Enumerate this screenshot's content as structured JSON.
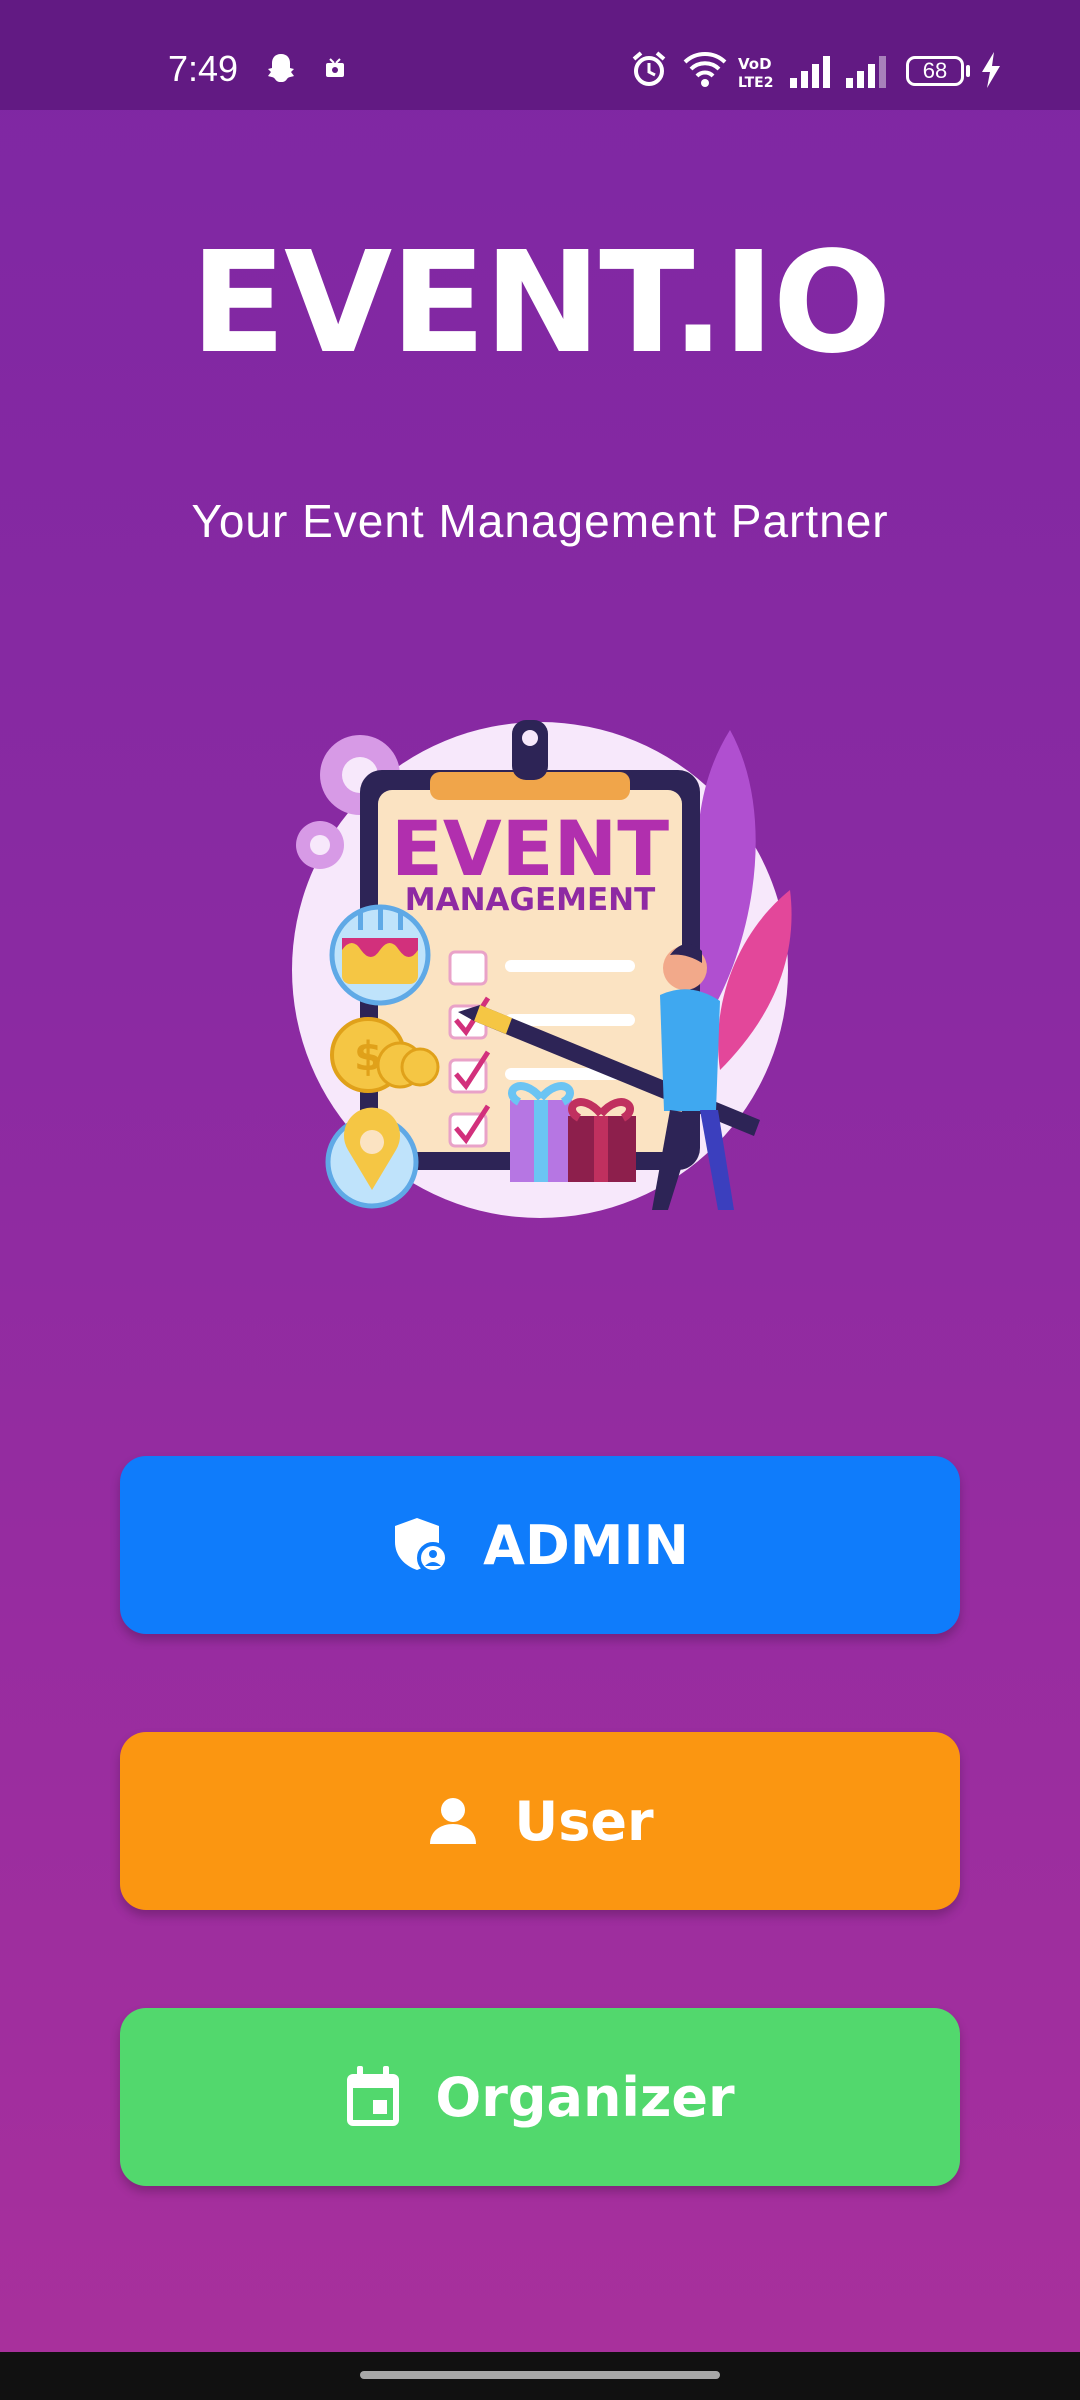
{
  "status_bar": {
    "time": "7:49",
    "battery_level": "68",
    "icons": [
      "snapchat-icon",
      "media-icon",
      "alarm-icon",
      "wifi-icon",
      "volte-icon",
      "signal-icon",
      "signal-icon-2",
      "battery-icon",
      "charging-icon"
    ]
  },
  "app": {
    "title": "EVENT.IO",
    "subtitle": "Your Event Management Partner"
  },
  "hero": {
    "heading": "EVENT",
    "subheading": "MANAGEMENT"
  },
  "buttons": {
    "admin": {
      "label": "ADMIN",
      "icon": "admin-shield-icon",
      "color": "#0f7cfb"
    },
    "user": {
      "label": "User",
      "icon": "person-icon",
      "color": "#fb9611"
    },
    "organizer": {
      "label": "Organizer",
      "icon": "calendar-icon",
      "color": "#52d86d"
    }
  },
  "colors": {
    "status_bar": "#621a83",
    "background_top": "#7e27a3",
    "background_bottom": "#a9309c"
  }
}
